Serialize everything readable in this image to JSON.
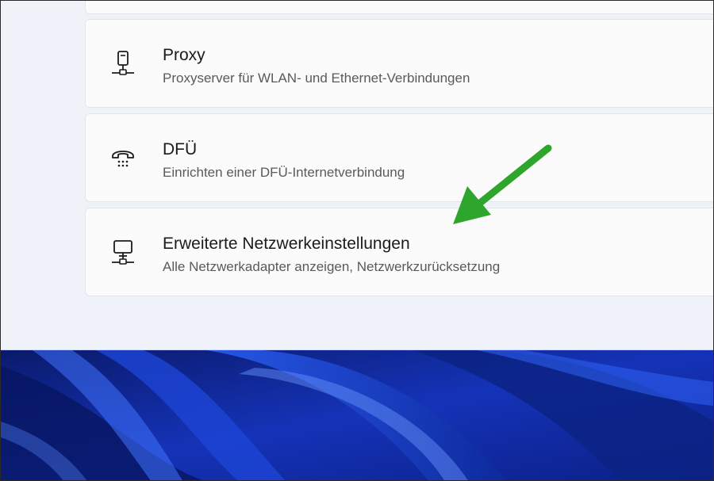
{
  "settings": {
    "items": [
      {
        "title": "Proxy",
        "subtitle": "Proxyserver für WLAN- und Ethernet-Verbindungen",
        "icon": "proxy-server-icon"
      },
      {
        "title": "DFÜ",
        "subtitle": "Einrichten einer DFÜ-Internetverbindung",
        "icon": "dial-up-phone-icon"
      },
      {
        "title": "Erweiterte Netzwerkeinstellungen",
        "subtitle": "Alle Netzwerkadapter anzeigen, Netzwerkzurücksetzung",
        "icon": "network-computer-icon"
      }
    ]
  },
  "annotation": {
    "arrow_color": "#2ea52b"
  },
  "wallpaper": {
    "colors": [
      "#0a1a6b",
      "#1f4be0",
      "#5d8cff"
    ]
  }
}
